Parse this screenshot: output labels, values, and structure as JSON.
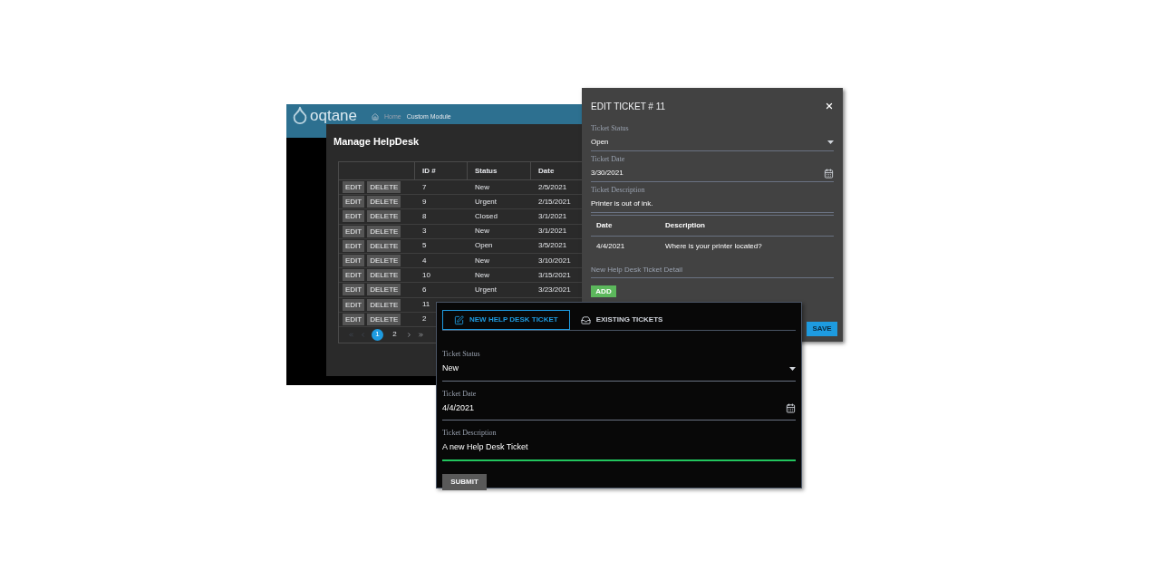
{
  "site": {
    "logo": "oqtane",
    "breadcrumb": [
      "Home",
      "Custom Module"
    ]
  },
  "manage": {
    "title": "Manage HelpDesk",
    "columns": [
      "ID #",
      "Status",
      "Date"
    ],
    "rows": [
      {
        "actions": [
          "EDIT",
          "DELETE"
        ],
        "id": "7",
        "status": "New",
        "date": "2/5/2021"
      },
      {
        "actions": [
          "EDIT",
          "DELETE"
        ],
        "id": "9",
        "status": "Urgent",
        "date": "2/15/2021"
      },
      {
        "actions": [
          "EDIT",
          "DELETE"
        ],
        "id": "8",
        "status": "Closed",
        "date": "3/1/2021"
      },
      {
        "actions": [
          "EDIT",
          "DELETE"
        ],
        "id": "3",
        "status": "New",
        "date": "3/1/2021"
      },
      {
        "actions": [
          "EDIT",
          "DELETE"
        ],
        "id": "5",
        "status": "Open",
        "date": "3/5/2021"
      },
      {
        "actions": [
          "EDIT",
          "DELETE"
        ],
        "id": "4",
        "status": "New",
        "date": "3/10/2021"
      },
      {
        "actions": [
          "EDIT",
          "DELETE"
        ],
        "id": "10",
        "status": "New",
        "date": "3/15/2021"
      },
      {
        "actions": [
          "EDIT",
          "DELETE"
        ],
        "id": "6",
        "status": "Urgent",
        "date": "3/23/2021"
      },
      {
        "actions": [
          "EDIT",
          "DELETE"
        ],
        "id": "11"
      },
      {
        "actions": [
          "EDIT",
          "DELETE"
        ],
        "id": "2"
      }
    ],
    "pages": [
      {
        "label": "1",
        "selected": true
      },
      {
        "label": "2",
        "selected": false
      }
    ]
  },
  "edit_dialog": {
    "title": "EDIT TICKET # 11",
    "fields": [
      {
        "kind": "select",
        "label": "Ticket Status",
        "value": "Open"
      },
      {
        "kind": "date",
        "label": "Ticket Date",
        "value": "3/30/2021"
      },
      {
        "kind": "text",
        "label": "Ticket Description",
        "value": "Printer is out of ink."
      }
    ],
    "details": {
      "columns": [
        "Date",
        "Description"
      ],
      "rows": [
        [
          "4/4/2021",
          "Where is your printer located?"
        ]
      ]
    },
    "new_detail": {
      "placeholder": "New Help Desk Ticket Detail"
    },
    "add_button": "ADD",
    "save_button": "SAVE"
  },
  "new_ticket": {
    "tabs": [
      {
        "label": "NEW HELP DESK TICKET",
        "kind": "edit",
        "selected": true
      },
      {
        "label": "EXISTING TICKETS",
        "kind": "inbox",
        "selected": false
      }
    ],
    "fields": [
      {
        "kind": "select",
        "label": "Ticket Status",
        "value": "New",
        "focused": false
      },
      {
        "kind": "date",
        "label": "Ticket Date",
        "value": "4/4/2021",
        "focused": false
      },
      {
        "kind": "text",
        "label": "Ticket Description",
        "value": "A new Help Desk Ticket",
        "focused": true
      }
    ],
    "submit_button": "SUBMIT"
  }
}
